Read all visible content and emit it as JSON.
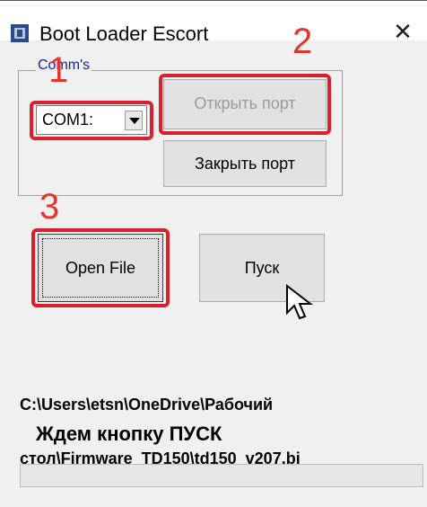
{
  "window": {
    "title": "Boot Loader Escort",
    "close_symbol": "✕"
  },
  "comms": {
    "legend": "Comm's",
    "port_value": "COM1:",
    "open_port_label": "Открыть порт",
    "close_port_label": "Закрыть порт"
  },
  "actions": {
    "open_file_label": "Open File",
    "start_label": "Пуск"
  },
  "file_path_lines": [
    "C:\\Users\\etsn\\OneDrive\\Рабочий",
    "стол\\Firmware  TD150\\td150  v207.bi"
  ],
  "status_text": "Ждем кнопку  ПУСК",
  "progress_fraction": 0,
  "annotations": {
    "one": "1",
    "two": "2",
    "three": "3"
  },
  "colors": {
    "annotation_red": "#d8202f",
    "legend_blue": "#1a22a8"
  }
}
